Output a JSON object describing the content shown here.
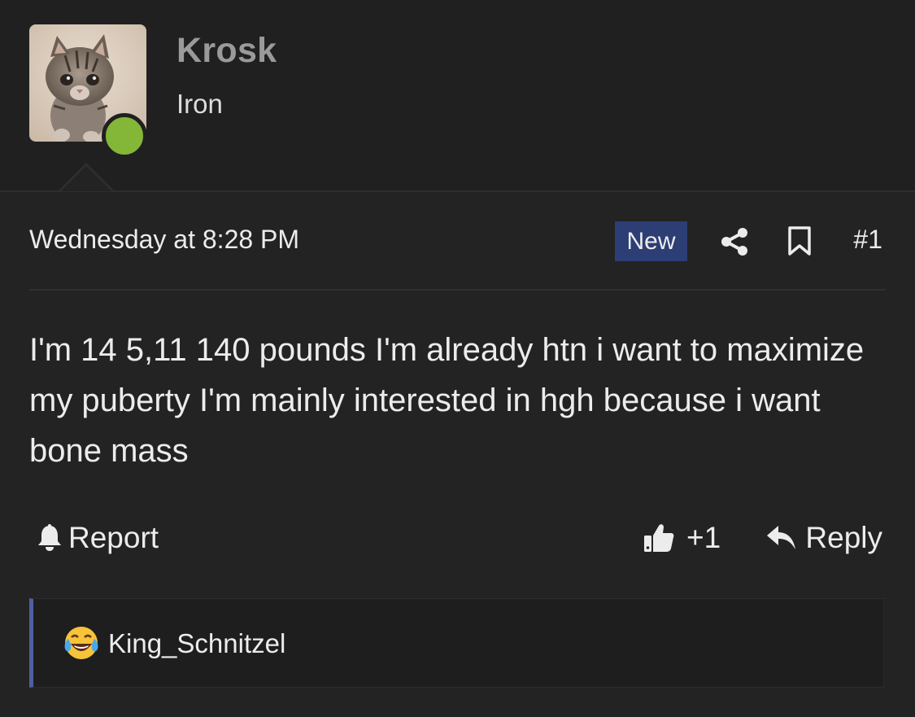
{
  "user": {
    "name": "Krosk",
    "title": "Iron",
    "online_color": "#84b637"
  },
  "post": {
    "date": "Wednesday at 8:28 PM",
    "badge": "New",
    "number": "#1",
    "message": "I'm 14 5,11 140 pounds I'm already htn i want to maximize my puberty I'm mainly interested in hgh because i want bone mass",
    "icons": [
      "share-icon",
      "bookmark-icon"
    ]
  },
  "actions": {
    "report_label": "Report",
    "like_label": "+1",
    "reply_label": "Reply"
  },
  "reactions": {
    "emoji": "face-with-tears-of-joy",
    "user": "King_Schnitzel"
  },
  "colors": {
    "badge_bg": "#2d3e75",
    "reaction_accent": "#4f5fa3",
    "background": "#232323"
  }
}
